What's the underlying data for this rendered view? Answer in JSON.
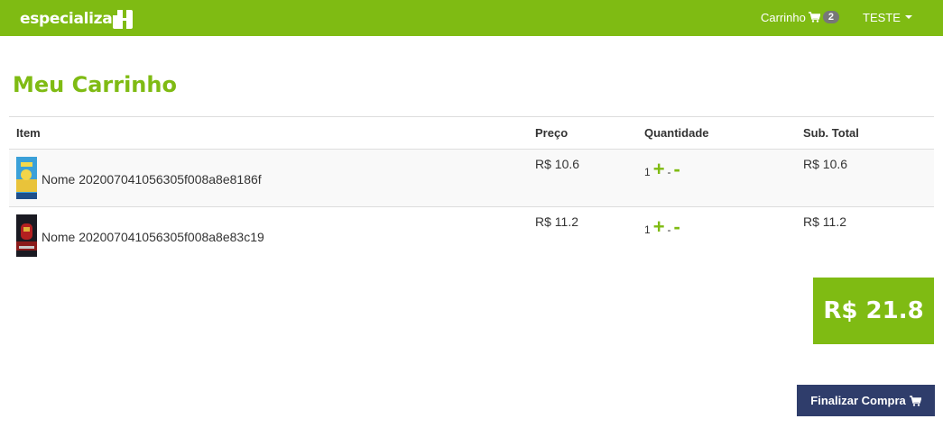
{
  "navbar": {
    "brand": "especializa",
    "cart_label": "Carrinho",
    "cart_count": "2",
    "user_label": "TESTE"
  },
  "page": {
    "title": "Meu Carrinho"
  },
  "table": {
    "headers": [
      "Item",
      "Preço",
      "Quantidade",
      "Sub. Total"
    ],
    "rows": [
      {
        "name": "Nome 202007041056305f008a8e8186f",
        "price": "R$ 10.6",
        "quantity": "1",
        "plus": "+",
        "sep": "-",
        "minus": "-",
        "subtotal": "R$ 10.6"
      },
      {
        "name": "Nome 202007041056305f008a8e83c19",
        "price": "R$ 11.2",
        "quantity": "1",
        "plus": "+",
        "sep": "-",
        "minus": "-",
        "subtotal": "R$ 11.2"
      }
    ]
  },
  "total": "R$ 21.8",
  "checkout_label": "Finalizar Compra",
  "colors": {
    "accent": "#7fbb13",
    "button": "#2f3d6b",
    "badge": "#777777"
  }
}
